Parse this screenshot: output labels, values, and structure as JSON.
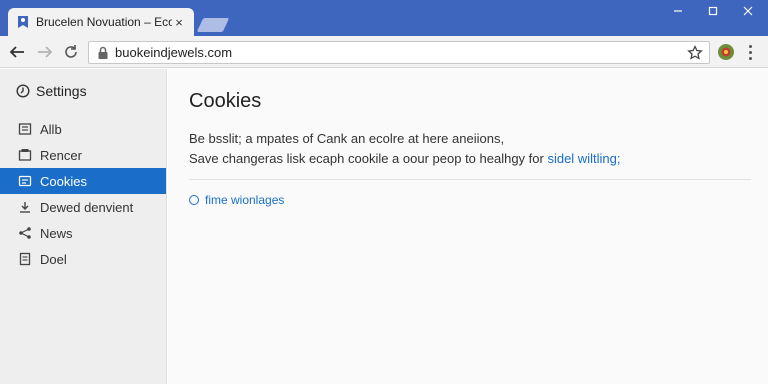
{
  "browser": {
    "tab_title": "Brucelen Novuation – Ecolrs",
    "tab_close": "×",
    "url": "buokeindjewels.com",
    "window_controls": {
      "minimize": "–",
      "maximize": "□",
      "close": "✕"
    }
  },
  "sidebar": {
    "header": "Settings",
    "items": [
      {
        "label": "Allb",
        "icon": "apps-icon"
      },
      {
        "label": "Rencer",
        "icon": "render-icon"
      },
      {
        "label": "Cookies",
        "icon": "cookie-icon",
        "active": true
      },
      {
        "label": "Dewed denvient",
        "icon": "download-icon"
      },
      {
        "label": "News",
        "icon": "share-icon"
      },
      {
        "label": "Doel",
        "icon": "document-icon"
      }
    ]
  },
  "main": {
    "title": "Cookies",
    "desc_line1": "Be bsslit; a mpates of Cank an ecolre at here aneiions,",
    "desc_line2_text": "Save changeras lisk ecaph cookile a oour peop to healhgy for ",
    "desc_line2_link": "sidel wiltling;",
    "option_label": "fime wionlages"
  },
  "colors": {
    "titlebar": "#3f66bf",
    "accent": "#1a6ec9",
    "sidebar_bg": "#eeeeee"
  }
}
